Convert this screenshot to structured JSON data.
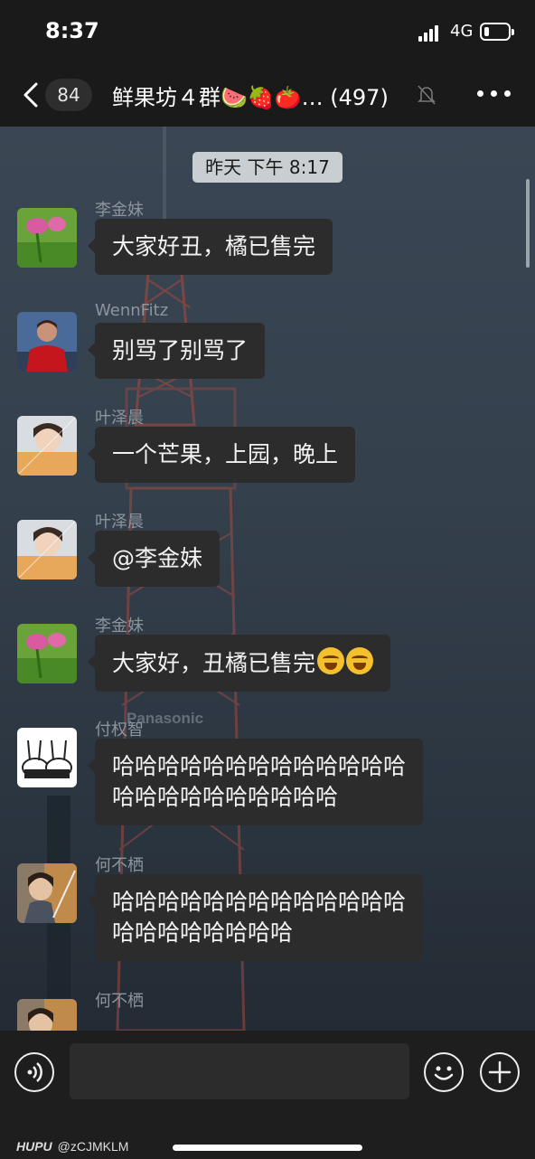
{
  "status_bar": {
    "time": "8:37",
    "network": "4G",
    "battery_level": 0.2
  },
  "nav": {
    "back_icon": "chevron-left-icon",
    "unread_count": "84",
    "title": "鲜果坊４群🍉🍓🍅… (497)",
    "mute_icon": "bell-slash-icon",
    "more_icon": "ellipsis-icon"
  },
  "timestamp": "昨天 下午 8:17",
  "messages": [
    {
      "sender": "李金妹",
      "text": "大家好丑，橘已售完",
      "avatar": "flower-avatar"
    },
    {
      "sender": "WennFitz",
      "text": "别骂了别骂了",
      "avatar": "soccer-player-avatar"
    },
    {
      "sender": "叶泽晨",
      "text": "一个芒果，上园，晚上",
      "avatar": "anime-boy-avatar"
    },
    {
      "sender": "叶泽晨",
      "text": "@李金妹",
      "avatar": "anime-boy-avatar"
    },
    {
      "sender": "李金妹",
      "text": "大家好，丑橘已售完",
      "emoji": "laughing-crying-emoji",
      "emoji_count": 2,
      "avatar": "flower-avatar"
    },
    {
      "sender": "付权智",
      "line1": "哈哈哈哈哈哈哈哈哈哈哈哈哈",
      "line2": "哈哈哈哈哈哈哈哈哈哈",
      "avatar": "bunny-cartoon-avatar"
    },
    {
      "sender": "何不栖",
      "line1": "哈哈哈哈哈哈哈哈哈哈哈哈哈",
      "line2": "哈哈哈哈哈哈哈哈",
      "avatar": "anime-swordsman-avatar"
    },
    {
      "sender": "何不栖",
      "avatar": "anime-swordsman-avatar"
    }
  ],
  "background": {
    "sign_text": "Panasonic"
  },
  "input_bar": {
    "voice_icon": "voice-icon",
    "emoji_icon": "smile-icon",
    "plus_icon": "plus-icon"
  },
  "watermark": {
    "brand": "HUPU",
    "handle": "@zCJMKLM"
  },
  "colors": {
    "bubble": "#2c2c2c",
    "nav_bg": "#1a1a1a",
    "timestamp_bg": "#c9ced3"
  }
}
